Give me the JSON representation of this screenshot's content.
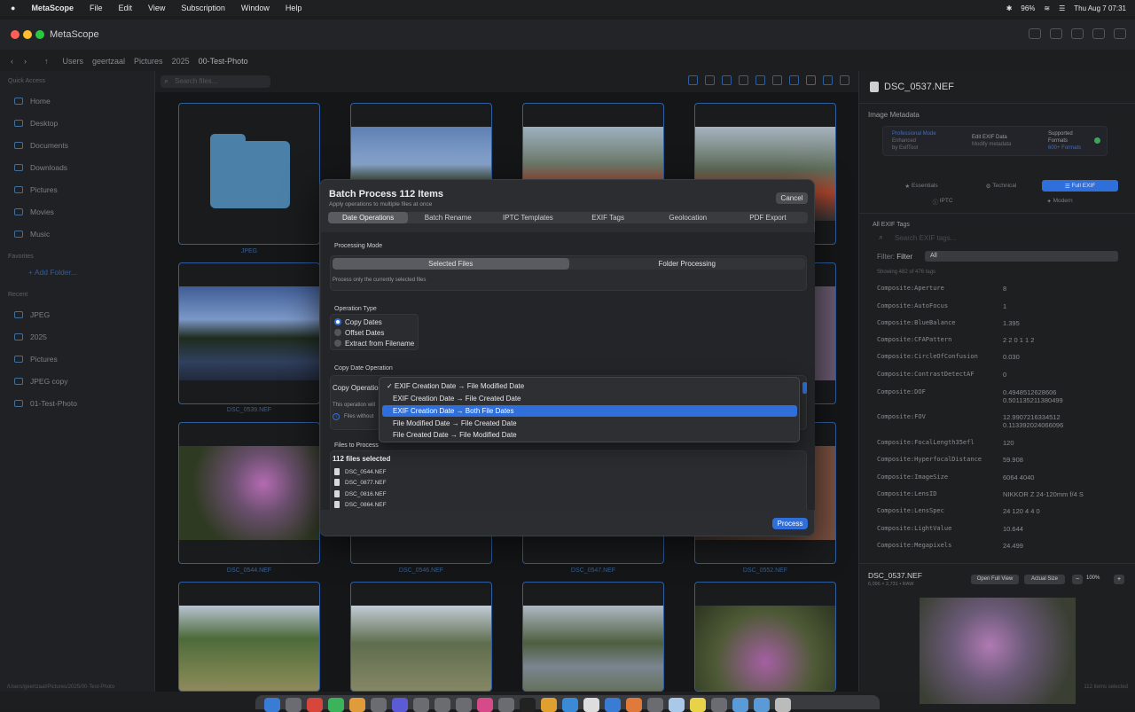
{
  "menubar": {
    "app": "MetaScope",
    "items": [
      "File",
      "Edit",
      "View",
      "Subscription",
      "Window",
      "Help"
    ],
    "battery": "96%",
    "clock": "Thu Aug 7  07:31"
  },
  "window": {
    "title": "MetaScope",
    "path": [
      "Users",
      "geertzaal",
      "Pictures",
      "2025",
      "00-Test-Photo"
    ]
  },
  "sidebar": {
    "quick_access_header": "Quick Access",
    "quick_access": [
      "Home",
      "Desktop",
      "Documents",
      "Downloads",
      "Pictures",
      "Movies",
      "Music"
    ],
    "favorites_header": "Favorites",
    "add_folder": "+ Add Folder...",
    "recent_header": "Recent",
    "recent": [
      "JPEG",
      "2025",
      "Pictures",
      "JPEG copy",
      "01-Test-Photo"
    ]
  },
  "toolbar": {
    "search_placeholder": "Search files..."
  },
  "grid": {
    "labels": [
      "JPEG",
      "DSC_0539.NEF",
      "DSC_0544.NEF",
      "DSC_0546.NEF",
      "DSC_0547.NEF",
      "DSC_0552.NEF"
    ]
  },
  "right_panel": {
    "file_name": "DSC_0537.NEF",
    "section_title": "Image Metadata",
    "mode_cards": [
      {
        "title": "Professional Mode",
        "line2": "Enhanced",
        "line3": "by ExifTool"
      },
      {
        "title": "Edit EXIF Data",
        "line2": "Modify metadata",
        "line3": ""
      },
      {
        "title": "Supported",
        "line2": "Formats",
        "line3": "600+ Formats"
      }
    ],
    "view_tabs": [
      "Essentials",
      "Technical",
      "Full EXIF",
      "IPTC",
      "Modern"
    ],
    "all_tags_title": "All EXIF Tags",
    "search_placeholder": "Search EXIF tags...",
    "filter_label": "Filter:",
    "filter_value": "Filter",
    "filter_select": "All",
    "showing": "Showing 482 of 476 tags",
    "tags": [
      {
        "k": "Composite:Aperture",
        "v": "8"
      },
      {
        "k": "Composite:AutoFocus",
        "v": "1"
      },
      {
        "k": "Composite:BlueBalance",
        "v": "1.395"
      },
      {
        "k": "Composite:CFAPattern",
        "v": "2 2 0 1 1 2"
      },
      {
        "k": "Composite:CircleOfConfusion",
        "v": "0.030"
      },
      {
        "k": "Composite:ContrastDetectAF",
        "v": "0"
      },
      {
        "k": "Composite:DOF",
        "v": "0.4948512628606\n0.501135211380499"
      },
      {
        "k": "Composite:FOV",
        "v": "12.9907216334512\n0.113392024066096"
      },
      {
        "k": "Composite:FocalLength35efl",
        "v": "120"
      },
      {
        "k": "Composite:HyperfocalDistance",
        "v": "59.908"
      },
      {
        "k": "Composite:ImageSize",
        "v": "6064 4040"
      },
      {
        "k": "Composite:LensID",
        "v": "NIKKOR Z 24-120mm f/4 S"
      },
      {
        "k": "Composite:LensSpec",
        "v": "24 120 4 4 0"
      },
      {
        "k": "Composite:LightValue",
        "v": "10.644"
      },
      {
        "k": "Composite:Megapixels",
        "v": "24.499"
      }
    ],
    "preview_name": "DSC_0537.NEF",
    "preview_info": "6,096 × 2,731 • RAW",
    "open_full": "Open Full View",
    "actual_size": "Actual Size",
    "zoom": "100%"
  },
  "status": {
    "path": "/Users/geertzaal/Pictures/2025/00-Test-Photo",
    "selected": "112 items selected"
  },
  "modal": {
    "title": "Batch Process 112 Items",
    "subtitle": "Apply operations to multiple files at once",
    "cancel": "Cancel",
    "tabs": [
      "Date Operations",
      "Batch Rename",
      "IPTC Templates",
      "EXIF Tags",
      "Geolocation",
      "PDF Export"
    ],
    "processing_mode_label": "Processing Mode",
    "mode_options": [
      "Selected Files",
      "Folder Processing"
    ],
    "mode_help": "Process only the currently selected files",
    "operation_type_label": "Operation Type",
    "operation_types": [
      "Copy Dates",
      "Offset Dates",
      "Extract from Filename"
    ],
    "copy_date_label": "Copy Date Operation",
    "copy_operation_label": "Copy Operation",
    "op_help": "This operation will",
    "info_text": "Files without",
    "files_label": "Files to Process",
    "files_count": "112 files selected",
    "files": [
      "DSC_0544.NEF",
      "DSC_0877.NEF",
      "DSC_0816.NEF",
      "DSC_0864.NEF"
    ],
    "process": "Process"
  },
  "dropdown": {
    "options": [
      "✓ EXIF Creation Date → File Modified Date",
      "EXIF Creation Date → File Created Date",
      "EXIF Creation Date → Both File Dates",
      "File Modified Date → File Created Date",
      "File Created Date → File Modified Date"
    ],
    "highlighted_index": 2
  },
  "colors": {
    "accent": "#2f6fdc",
    "tile_border": "#2f5fa0"
  }
}
